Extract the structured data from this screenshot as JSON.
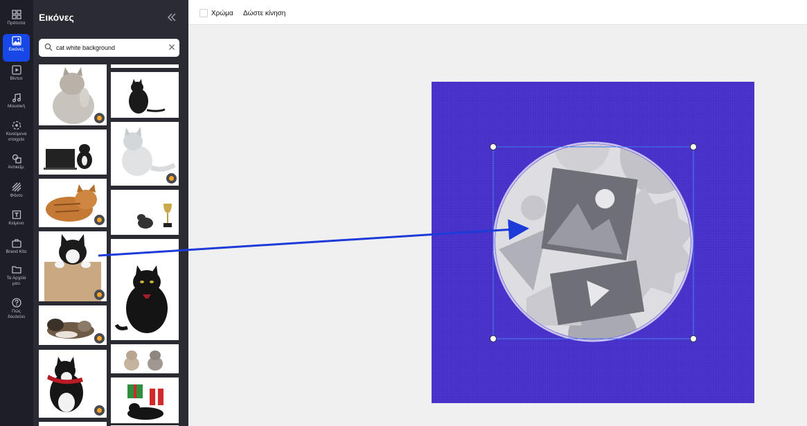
{
  "rail": {
    "items": [
      {
        "label": "Πρότυπα",
        "icon": "templates-icon"
      },
      {
        "label": "Εικόνες",
        "icon": "image-icon"
      },
      {
        "label": "Βίντεο",
        "icon": "video-icon"
      },
      {
        "label": "Μουσική",
        "icon": "music-icon"
      },
      {
        "label": "Κινούμενα στοιχεία",
        "icon": "animation-icon"
      },
      {
        "label": "Αντικείμ.",
        "icon": "shapes-icon"
      },
      {
        "label": "Φόντο",
        "icon": "background-icon"
      },
      {
        "label": "Κείμενο",
        "icon": "text-icon"
      },
      {
        "label": "Brand Kits",
        "icon": "briefcase-icon"
      },
      {
        "label": "Τα Αρχεία μου",
        "icon": "folder-icon"
      },
      {
        "label": "Πώς δουλεύει",
        "icon": "help-icon"
      }
    ]
  },
  "panel": {
    "title": "Εικόνες",
    "search_value": "cat white background"
  },
  "toolbar": {
    "color_label": "Χρώμα",
    "motion_label": "Δώστε κίνηση"
  },
  "colors": {
    "accent": "#1747e6",
    "canvas_bg": "#4630c9",
    "arrow": "#1c3bd9",
    "premium_badge": "#f5a623"
  }
}
